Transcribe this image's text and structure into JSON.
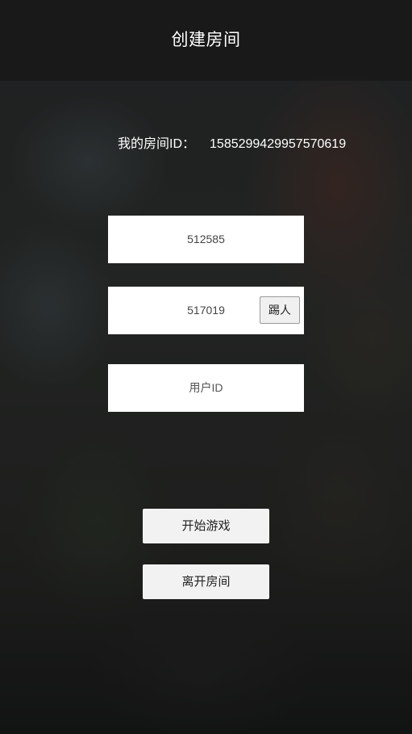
{
  "header": {
    "title": "创建房间"
  },
  "room": {
    "label": "我的房间ID：",
    "id_value": "1585299429957570619"
  },
  "players": [
    {
      "value": "512585"
    },
    {
      "value": "517019",
      "kick_label": "踢人"
    }
  ],
  "user_id_input": {
    "placeholder": "用户ID"
  },
  "actions": {
    "start_label": "开始游戏",
    "leave_label": "离开房间"
  }
}
